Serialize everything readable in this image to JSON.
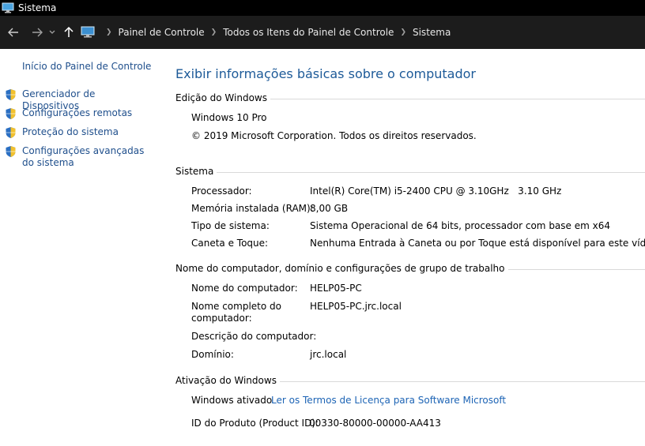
{
  "window": {
    "title": "Sistema"
  },
  "nav": {
    "breadcrumbs": [
      "Painel de Controle",
      "Todos os Itens do Painel de Controle",
      "Sistema"
    ]
  },
  "sidebar": {
    "home": "Início do Painel de Controle",
    "items": [
      {
        "label": "Gerenciador de Dispositivos"
      },
      {
        "label": "Configurações remotas"
      },
      {
        "label": "Proteção do sistema"
      },
      {
        "label": "Configurações avançadas do sistema"
      }
    ]
  },
  "main": {
    "title": "Exibir informações básicas sobre o computador",
    "edition": {
      "heading": "Edição do Windows",
      "name": "Windows 10 Pro",
      "copyright": "© 2019 Microsoft Corporation. Todos os direitos reservados."
    },
    "system": {
      "heading": "Sistema",
      "rows": [
        {
          "label": "Processador:",
          "value": "Intel(R) Core(TM) i5-2400 CPU @ 3.10GHz   3.10 GHz"
        },
        {
          "label": "Memória instalada (RAM):",
          "value": "8,00 GB"
        },
        {
          "label": "Tipo de sistema:",
          "value": "Sistema Operacional de 64 bits, processador com base em x64"
        },
        {
          "label": "Caneta e Toque:",
          "value": "Nenhuma Entrada à Caneta ou por Toque está disponível para este vídeo"
        }
      ]
    },
    "computer": {
      "heading": "Nome do computador, domínio e configurações de grupo de trabalho",
      "rows": [
        {
          "label": "Nome do computador:",
          "value": "HELP05-PC"
        },
        {
          "label": "Nome completo do computador:",
          "value": "HELP05-PC.jrc.local"
        },
        {
          "label": "Descrição do computador:",
          "value": ""
        },
        {
          "label": "Domínio:",
          "value": "jrc.local"
        }
      ]
    },
    "activation": {
      "heading": "Ativação do Windows",
      "status": "Windows ativado",
      "license_link": "Ler os Termos de Licença para Software Microsoft",
      "product_id_label": "ID do Produto (Product ID):",
      "product_id": "00330-80000-00000-AA413"
    }
  },
  "colors": {
    "titlebar_bg": "#000000",
    "navbar_bg": "#1c1c1c",
    "link": "#1d64b5",
    "heading_blue": "#1d5a98",
    "sidebar_link": "#1f4f8c"
  },
  "icons": [
    "monitor-icon",
    "back-arrow-icon",
    "forward-arrow-icon",
    "chevron-down-icon",
    "up-arrow-icon",
    "shield-icon"
  ]
}
